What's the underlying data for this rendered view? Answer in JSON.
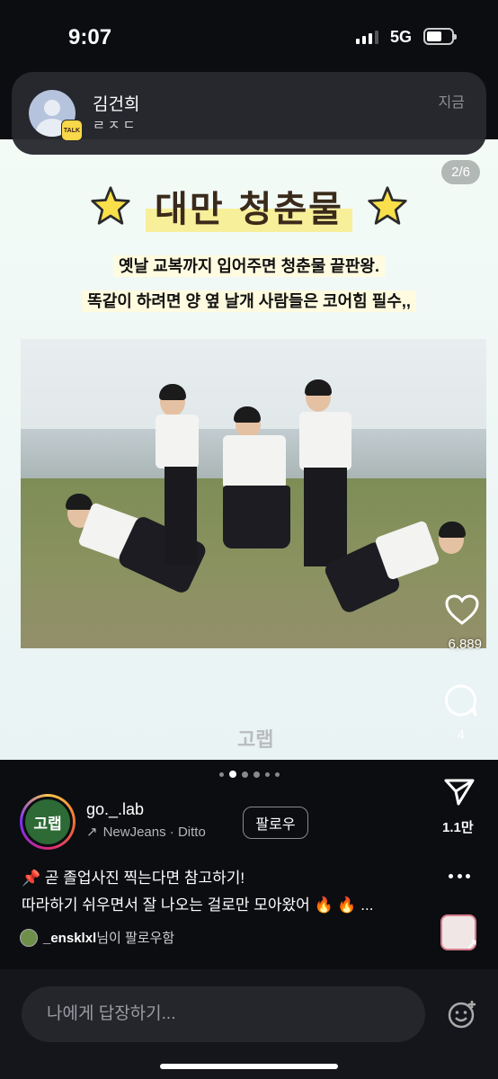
{
  "status_bar": {
    "time": "9:07",
    "network": "5G"
  },
  "notification": {
    "sender": "김건희",
    "message": "ㄹㅈㄷ",
    "time": "지금",
    "app_badge": "TALK"
  },
  "post": {
    "page_counter": "2/6",
    "title": "대만 청춘물",
    "subtitle_1": "옛날 교복까지 입어주면 청춘물 끝판왕.",
    "subtitle_2": "똑같이 하려면 양 옆 날개 사람들은 코어힘 필수,,",
    "brand_mark": "고랩",
    "likes": "6,889",
    "comments": "4"
  },
  "account": {
    "avatar_text": "고랩",
    "username": "go._.lab",
    "music": "NewJeans · Ditto",
    "follow_label": "팔로우",
    "shares": "1.1만"
  },
  "caption": {
    "line1": "📌 곧 졸업사진 찍는다면 참고하기!",
    "line2": "따라하기 쉬우면서 잘 나오는 걸로만 모아왔어 🔥 🔥 ..."
  },
  "follower_note": {
    "user": "_ensklxl",
    "suffix": "님이 팔로우함"
  },
  "reply": {
    "placeholder": "나에게 답장하기..."
  },
  "carousel": {
    "current": 2,
    "total": 6
  }
}
